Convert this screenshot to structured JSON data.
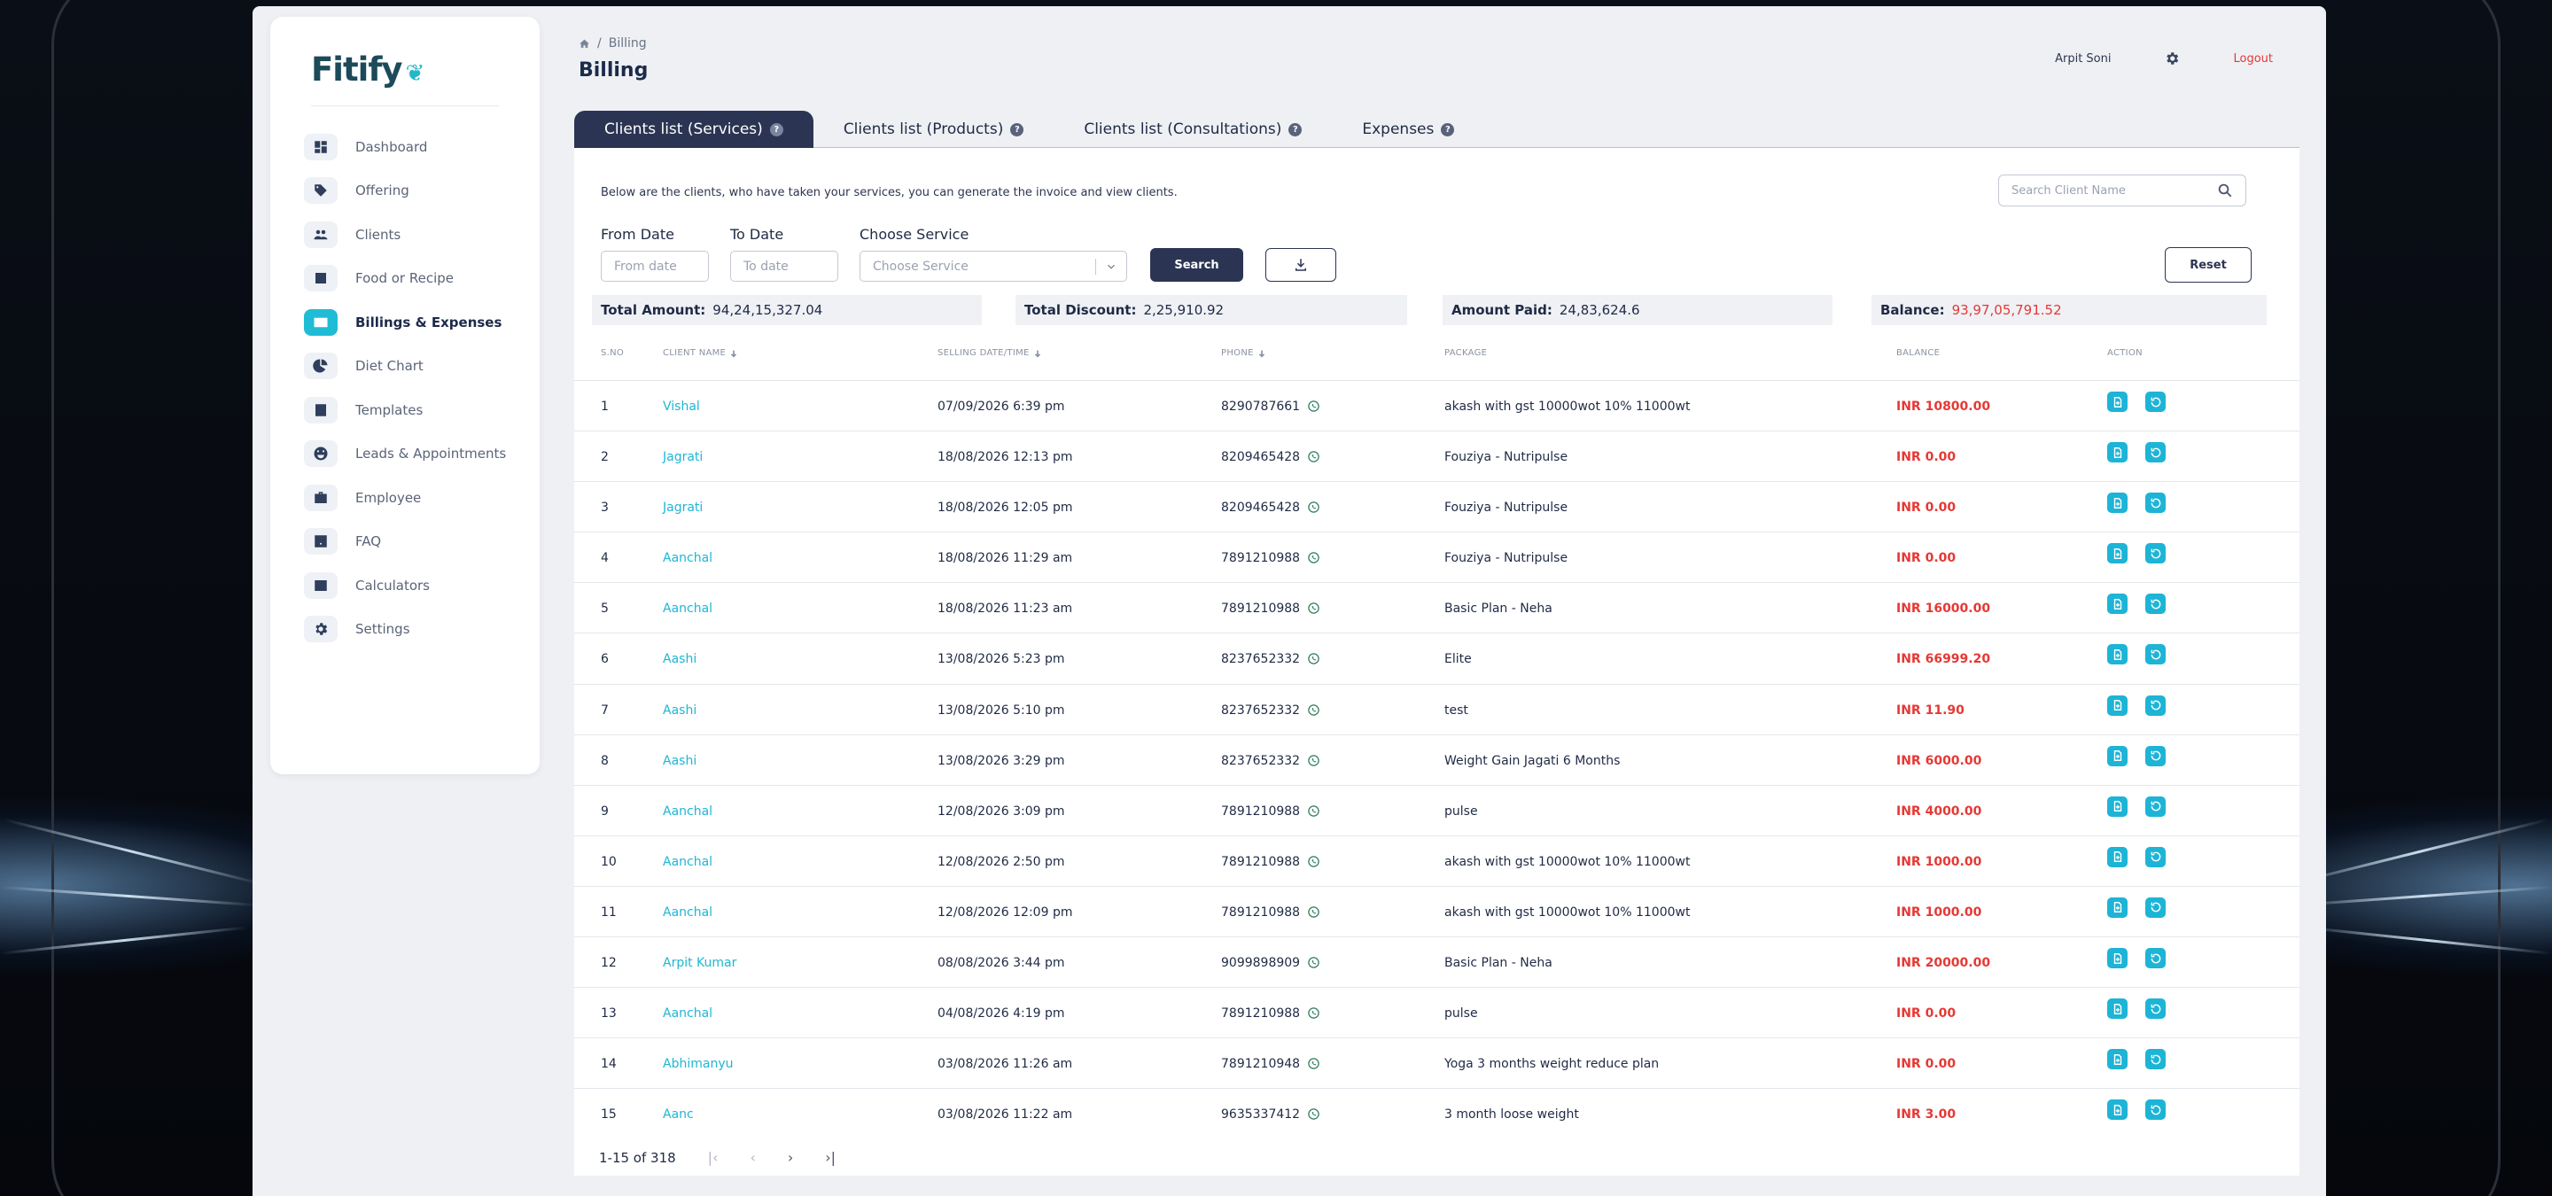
{
  "app": {
    "logo": "Fitify"
  },
  "sidebar": {
    "items": [
      {
        "label": "Dashboard",
        "icon": "dashboard-icon"
      },
      {
        "label": "Offering",
        "icon": "tag-icon"
      },
      {
        "label": "Clients",
        "icon": "clients-icon"
      },
      {
        "label": "Food or Recipe",
        "icon": "recipe-icon"
      },
      {
        "label": "Billings & Expenses",
        "icon": "billing-card-icon",
        "active": true
      },
      {
        "label": "Diet Chart",
        "icon": "pie-chart-icon"
      },
      {
        "label": "Templates",
        "icon": "template-icon"
      },
      {
        "label": "Leads & Appointments",
        "icon": "leads-icon"
      },
      {
        "label": "Employee",
        "icon": "briefcase-icon"
      },
      {
        "label": "FAQ",
        "icon": "question-icon"
      },
      {
        "label": "Calculators",
        "icon": "calculator-icon"
      },
      {
        "label": "Settings",
        "icon": "gear-icon"
      }
    ]
  },
  "header": {
    "breadcrumb": "Billing",
    "title": "Billing",
    "user": "Arpit Soni",
    "logout": "Logout"
  },
  "tabs": [
    {
      "label": "Clients list (Services)",
      "active": true
    },
    {
      "label": "Clients list (Products)"
    },
    {
      "label": "Clients list (Consultations)"
    },
    {
      "label": "Expenses"
    }
  ],
  "filters": {
    "description": "Below are the clients, who have taken your services, you can generate the invoice and view clients.",
    "search_placeholder": "Search Client Name",
    "from_label": "From Date",
    "from_placeholder": "From date",
    "to_label": "To Date",
    "to_placeholder": "To date",
    "service_label": "Choose Service",
    "service_placeholder": "Choose Service",
    "search_button": "Search",
    "reset_button": "Reset"
  },
  "summary": {
    "total_amount_label": "Total Amount:",
    "total_amount": "94,24,15,327.04",
    "total_discount_label": "Total Discount:",
    "total_discount": "2,25,910.92",
    "amount_paid_label": "Amount Paid:",
    "amount_paid": "24,83,624.6",
    "balance_label": "Balance:",
    "balance": "93,97,05,791.52"
  },
  "table": {
    "columns": [
      "S.NO",
      "CLIENT NAME",
      "SELLING DATE/TIME",
      "PHONE",
      "PACKAGE",
      "BALANCE",
      "ACTION"
    ],
    "rows": [
      {
        "sno": "1",
        "client": "Vishal",
        "date": "07/09/2026 6:39 pm",
        "phone": "8290787661",
        "package": "akash with gst 10000wot 10% 11000wt",
        "balance": "INR 10800.00"
      },
      {
        "sno": "2",
        "client": "Jagrati",
        "date": "18/08/2026 12:13 pm",
        "phone": "8209465428",
        "package": "Fouziya - Nutripulse",
        "balance": "INR 0.00"
      },
      {
        "sno": "3",
        "client": "Jagrati",
        "date": "18/08/2026 12:05 pm",
        "phone": "8209465428",
        "package": "Fouziya - Nutripulse",
        "balance": "INR 0.00"
      },
      {
        "sno": "4",
        "client": "Aanchal",
        "date": "18/08/2026 11:29 am",
        "phone": "7891210988",
        "package": "Fouziya - Nutripulse",
        "balance": "INR 0.00"
      },
      {
        "sno": "5",
        "client": "Aanchal",
        "date": "18/08/2026 11:23 am",
        "phone": "7891210988",
        "package": "Basic Plan - Neha",
        "balance": "INR 16000.00"
      },
      {
        "sno": "6",
        "client": "Aashi",
        "date": "13/08/2026 5:23 pm",
        "phone": "8237652332",
        "package": "Elite",
        "balance": "INR 66999.20"
      },
      {
        "sno": "7",
        "client": "Aashi",
        "date": "13/08/2026 5:10 pm",
        "phone": "8237652332",
        "package": "test",
        "balance": "INR 11.90"
      },
      {
        "sno": "8",
        "client": "Aashi",
        "date": "13/08/2026 3:29 pm",
        "phone": "8237652332",
        "package": "Weight Gain Jagati 6 Months",
        "balance": "INR 6000.00"
      },
      {
        "sno": "9",
        "client": "Aanchal",
        "date": "12/08/2026 3:09 pm",
        "phone": "7891210988",
        "package": "pulse",
        "balance": "INR 4000.00"
      },
      {
        "sno": "10",
        "client": "Aanchal",
        "date": "12/08/2026 2:50 pm",
        "phone": "7891210988",
        "package": "akash with gst 10000wot 10% 11000wt",
        "balance": "INR 1000.00"
      },
      {
        "sno": "11",
        "client": "Aanchal",
        "date": "12/08/2026 12:09 pm",
        "phone": "7891210988",
        "package": "akash with gst 10000wot 10% 11000wt",
        "balance": "INR 1000.00"
      },
      {
        "sno": "12",
        "client": "Arpit Kumar",
        "date": "08/08/2026 3:44 pm",
        "phone": "9099898909",
        "package": "Basic Plan - Neha",
        "balance": "INR 20000.00"
      },
      {
        "sno": "13",
        "client": "Aanchal",
        "date": "04/08/2026 4:19 pm",
        "phone": "7891210988",
        "package": "pulse",
        "balance": "INR 0.00"
      },
      {
        "sno": "14",
        "client": "Abhimanyu",
        "date": "03/08/2026 11:26 am",
        "phone": "7891210948",
        "package": "Yoga 3 months weight reduce plan",
        "balance": "INR 0.00"
      },
      {
        "sno": "15",
        "client": "Aanc",
        "date": "03/08/2026 11:22 am",
        "phone": "9635337412",
        "package": "3 month loose weight",
        "balance": "INR 3.00"
      }
    ]
  },
  "pagination": {
    "range": "1-15 of 318"
  },
  "colors": {
    "primary": "#2b3553",
    "accent": "#1db4d6",
    "danger": "#e53935"
  }
}
